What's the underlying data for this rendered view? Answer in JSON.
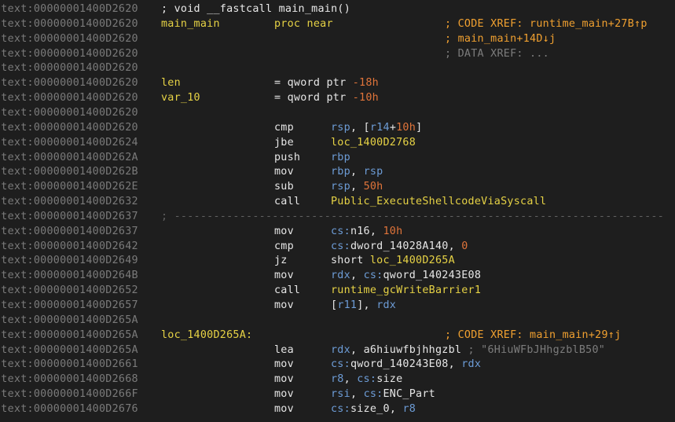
{
  "lines": [
    {
      "addr": ".text:00000001400D2620",
      "func": "; void __fastcall main_main()"
    },
    {
      "addr": ".text:00000001400D2620",
      "label": "main_main",
      "mn": "proc near",
      "cmt": [
        {
          "t": "; CODE XREF: runtime_main+27B↑p",
          "c": "cmt"
        }
      ]
    },
    {
      "addr": ".text:00000001400D2620",
      "cmt": [
        {
          "t": "; main_main+14D↓j",
          "c": "cmt"
        }
      ]
    },
    {
      "addr": ".text:00000001400D2620",
      "cmt": [
        {
          "t": "; DATA XREF: ...",
          "c": "dim"
        }
      ]
    },
    {
      "addr": ".text:00000001400D2620"
    },
    {
      "addr": ".text:00000001400D2620",
      "label": "len",
      "mn": "= qword ptr -18h",
      "mnparts": [
        {
          "t": "= qword ptr ",
          "c": "white"
        },
        {
          "t": "-18h",
          "c": "orange"
        }
      ]
    },
    {
      "addr": ".text:00000001400D2620",
      "label": "var_10",
      "mnparts": [
        {
          "t": "= qword ptr ",
          "c": "white"
        },
        {
          "t": "-10h",
          "c": "orange"
        }
      ]
    },
    {
      "addr": ".text:00000001400D2620"
    },
    {
      "addr": ".text:00000001400D2620",
      "mn": "cmp",
      "ops": [
        {
          "t": "rsp",
          "c": "blue"
        },
        {
          "t": ", [",
          "c": "white"
        },
        {
          "t": "r14",
          "c": "blue"
        },
        {
          "t": "+",
          "c": "white"
        },
        {
          "t": "10h",
          "c": "orange"
        },
        {
          "t": "]",
          "c": "white"
        }
      ]
    },
    {
      "addr": ".text:00000001400D2624",
      "mn": "jbe",
      "ops": [
        {
          "t": "loc_1400D2768",
          "c": "yellow"
        }
      ]
    },
    {
      "addr": ".text:00000001400D262A",
      "mn": "push",
      "ops": [
        {
          "t": "rbp",
          "c": "blue"
        }
      ]
    },
    {
      "addr": ".text:00000001400D262B",
      "mn": "mov",
      "ops": [
        {
          "t": "rbp",
          "c": "blue"
        },
        {
          "t": ", ",
          "c": "white"
        },
        {
          "t": "rsp",
          "c": "blue"
        }
      ]
    },
    {
      "addr": ".text:00000001400D262E",
      "mn": "sub",
      "ops": [
        {
          "t": "rsp",
          "c": "blue"
        },
        {
          "t": ", ",
          "c": "white"
        },
        {
          "t": "50h",
          "c": "orange"
        }
      ]
    },
    {
      "addr": ".text:00000001400D2632",
      "mn": "call",
      "ops": [
        {
          "t": "Public_ExecuteShellcodeViaSyscall",
          "c": "yellow"
        }
      ]
    },
    {
      "addr": ".text:00000001400D2637",
      "sep": "; ---------------------------------------------------------------------------"
    },
    {
      "addr": ".text:00000001400D2637",
      "mn": "mov",
      "ops": [
        {
          "t": "cs:",
          "c": "blue"
        },
        {
          "t": "n16",
          "c": "white"
        },
        {
          "t": ", ",
          "c": "white"
        },
        {
          "t": "10h",
          "c": "orange"
        }
      ]
    },
    {
      "addr": ".text:00000001400D2642",
      "mn": "cmp",
      "ops": [
        {
          "t": "cs:",
          "c": "blue"
        },
        {
          "t": "dword_14028A140",
          "c": "white"
        },
        {
          "t": ", ",
          "c": "white"
        },
        {
          "t": "0",
          "c": "orange"
        }
      ]
    },
    {
      "addr": ".text:00000001400D2649",
      "mn": "jz",
      "ops": [
        {
          "t": "short ",
          "c": "white"
        },
        {
          "t": "loc_1400D265A",
          "c": "yellow"
        }
      ]
    },
    {
      "addr": ".text:00000001400D264B",
      "mn": "mov",
      "ops": [
        {
          "t": "rdx",
          "c": "blue"
        },
        {
          "t": ", ",
          "c": "white"
        },
        {
          "t": "cs:",
          "c": "blue"
        },
        {
          "t": "qword_140243E08",
          "c": "white"
        }
      ]
    },
    {
      "addr": ".text:00000001400D2652",
      "mn": "call",
      "ops": [
        {
          "t": "runtime_gcWriteBarrier1",
          "c": "yellow"
        }
      ]
    },
    {
      "addr": ".text:00000001400D2657",
      "mn": "mov",
      "ops": [
        {
          "t": "[",
          "c": "white"
        },
        {
          "t": "r11",
          "c": "blue"
        },
        {
          "t": "], ",
          "c": "white"
        },
        {
          "t": "rdx",
          "c": "blue"
        }
      ]
    },
    {
      "addr": ".text:00000001400D265A"
    },
    {
      "addr": ".text:00000001400D265A",
      "label": "loc_1400D265A:",
      "cmt": [
        {
          "t": "; CODE XREF: main_main+29↑j",
          "c": "cmt"
        }
      ]
    },
    {
      "addr": ".text:00000001400D265A",
      "mn": "lea",
      "ops": [
        {
          "t": "rdx",
          "c": "blue"
        },
        {
          "t": ", ",
          "c": "white"
        },
        {
          "t": "a6hiuwfbjhhgzbl",
          "c": "white"
        },
        {
          "t": " ; \"6HiuWFbJHhgzblB50\"",
          "c": "dim"
        }
      ]
    },
    {
      "addr": ".text:00000001400D2661",
      "mn": "mov",
      "ops": [
        {
          "t": "cs:",
          "c": "blue"
        },
        {
          "t": "qword_140243E08",
          "c": "white"
        },
        {
          "t": ", ",
          "c": "white"
        },
        {
          "t": "rdx",
          "c": "blue"
        }
      ]
    },
    {
      "addr": ".text:00000001400D2668",
      "mn": "mov",
      "ops": [
        {
          "t": "r8",
          "c": "blue"
        },
        {
          "t": ", ",
          "c": "white"
        },
        {
          "t": "cs:",
          "c": "blue"
        },
        {
          "t": "size",
          "c": "white"
        }
      ]
    },
    {
      "addr": ".text:00000001400D266F",
      "mn": "mov",
      "ops": [
        {
          "t": "rsi",
          "c": "blue"
        },
        {
          "t": ", ",
          "c": "white"
        },
        {
          "t": "cs:",
          "c": "blue"
        },
        {
          "t": "ENC_Part",
          "c": "white"
        }
      ]
    },
    {
      "addr": ".text:00000001400D2676",
      "mn": "mov",
      "ops": [
        {
          "t": "cs:",
          "c": "blue"
        },
        {
          "t": "size_0",
          "c": "white"
        },
        {
          "t": ", ",
          "c": "white"
        },
        {
          "t": "r8",
          "c": "blue"
        }
      ]
    }
  ]
}
